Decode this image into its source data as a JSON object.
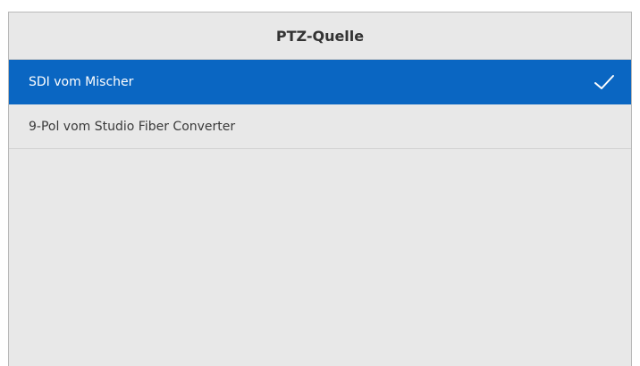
{
  "dialog": {
    "title": "PTZ-Quelle",
    "options": [
      {
        "label": "SDI vom Mischer",
        "selected": true
      },
      {
        "label": "9-Pol vom Studio Fiber Converter",
        "selected": false
      }
    ]
  },
  "colors": {
    "selected_background": "#0a66c2",
    "panel_background": "#e8e8e8"
  },
  "icons": {
    "selected_marker": "checkmark-icon"
  }
}
